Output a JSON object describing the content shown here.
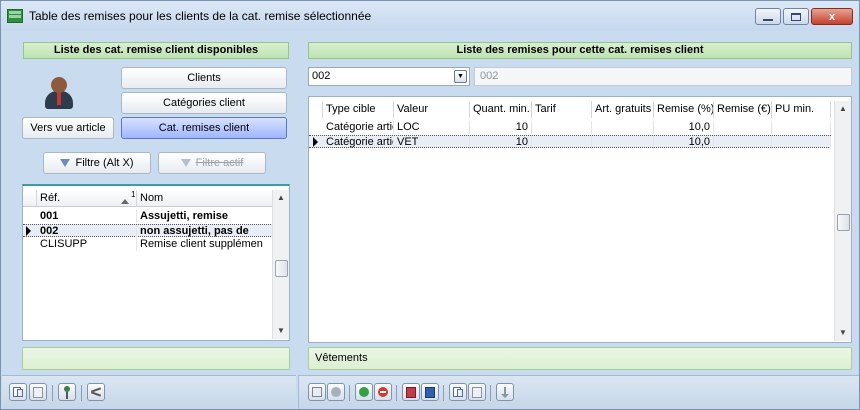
{
  "window": {
    "title": "Table des remises pour les clients de la cat. remise sélectionnée",
    "close_label": "x"
  },
  "left": {
    "header": "Liste des cat. remise client disponibles",
    "buttons": {
      "clients": "Clients",
      "categories": "Catégories client",
      "view_article": "Vers vue article",
      "cat_remises": "Cat. remises client",
      "filter": "Filtre (Alt X)",
      "filter_active": "Filtre actif"
    },
    "grid": {
      "columns": [
        "Réf.",
        "Nom"
      ],
      "sort_index": "1",
      "rows": [
        {
          "ref": "001",
          "nom": "Assujetti, remise"
        },
        {
          "ref": "002",
          "nom": "non assujetti, pas de"
        },
        {
          "ref": "CLISUPP",
          "nom": "Remise client supplémen"
        }
      ]
    },
    "status": ""
  },
  "right": {
    "header": "Liste des remises pour cette cat. remises client",
    "select_value": "002",
    "readonly_value": "002",
    "grid": {
      "columns": [
        "Type cible",
        "Valeur",
        "Quant. min.",
        "Tarif",
        "Art. gratuits",
        "Remise (%)",
        "Remise (€)",
        "PU min."
      ],
      "rows": [
        {
          "type": "Catégorie artic",
          "valeur": "LOC",
          "quant": "10",
          "tarif": "",
          "gratuits": "",
          "remise_pct": "10,0",
          "remise_eur": "",
          "pu": ""
        },
        {
          "type": "Catégorie artic",
          "valeur": "VET",
          "quant": "10",
          "tarif": "",
          "gratuits": "",
          "remise_pct": "10,0",
          "remise_eur": "",
          "pu": ""
        }
      ]
    },
    "status": "Vêtements"
  }
}
